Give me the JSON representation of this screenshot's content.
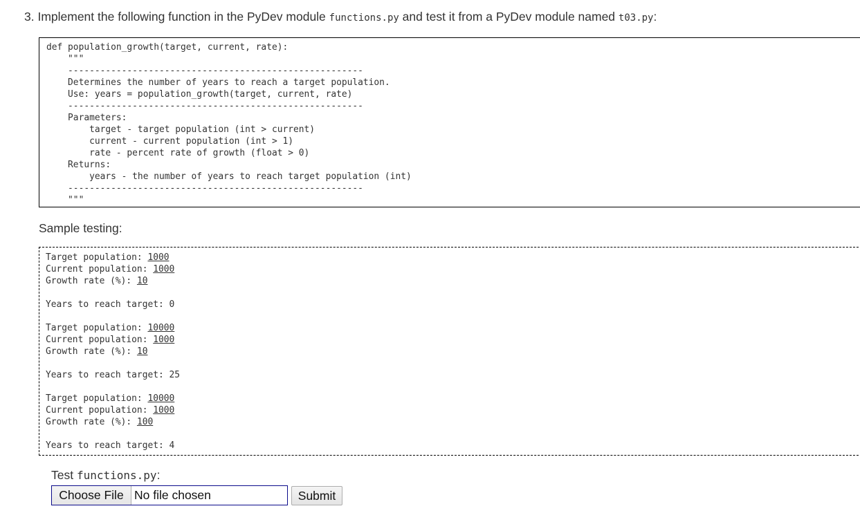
{
  "question": {
    "prefix": "3. Implement the following function in the PyDev module ",
    "module": "functions.py",
    "middle": " and test it from a PyDev module named ",
    "test_module": "t03.py",
    "suffix": ":"
  },
  "code_listing": [
    "def population_growth(target, current, rate):",
    "    \"\"\"",
    "    -------------------------------------------------------",
    "    Determines the number of years to reach a target population.",
    "    Use: years = population_growth(target, current, rate)",
    "    -------------------------------------------------------",
    "    Parameters:",
    "        target - target population (int > current)",
    "        current - current population (int > 1)",
    "        rate - percent rate of growth (float > 0)",
    "    Returns:",
    "        years - the number of years to reach target population (int)",
    "    -------------------------------------------------------",
    "    \"\"\""
  ],
  "sample": {
    "label": "Sample testing:",
    "runs": [
      {
        "target_label": "Target population: ",
        "target": "1000",
        "current_label": "Current population: ",
        "current": "1000",
        "rate_label": "Growth rate (%): ",
        "rate": "10",
        "result": "Years to reach target: 0"
      },
      {
        "target_label": "Target population: ",
        "target": "10000",
        "current_label": "Current population: ",
        "current": "1000",
        "rate_label": "Growth rate (%): ",
        "rate": "10",
        "result": "Years to reach target: 25"
      },
      {
        "target_label": "Target population: ",
        "target": "10000",
        "current_label": "Current population: ",
        "current": "1000",
        "rate_label": "Growth rate (%): ",
        "rate": "100",
        "result": "Years to reach target: 4"
      }
    ]
  },
  "upload": {
    "label_prefix": "Test ",
    "label_file": "functions.py",
    "label_suffix": ":",
    "choose_label": "Choose File",
    "status": "No file chosen",
    "submit_label": "Submit"
  }
}
